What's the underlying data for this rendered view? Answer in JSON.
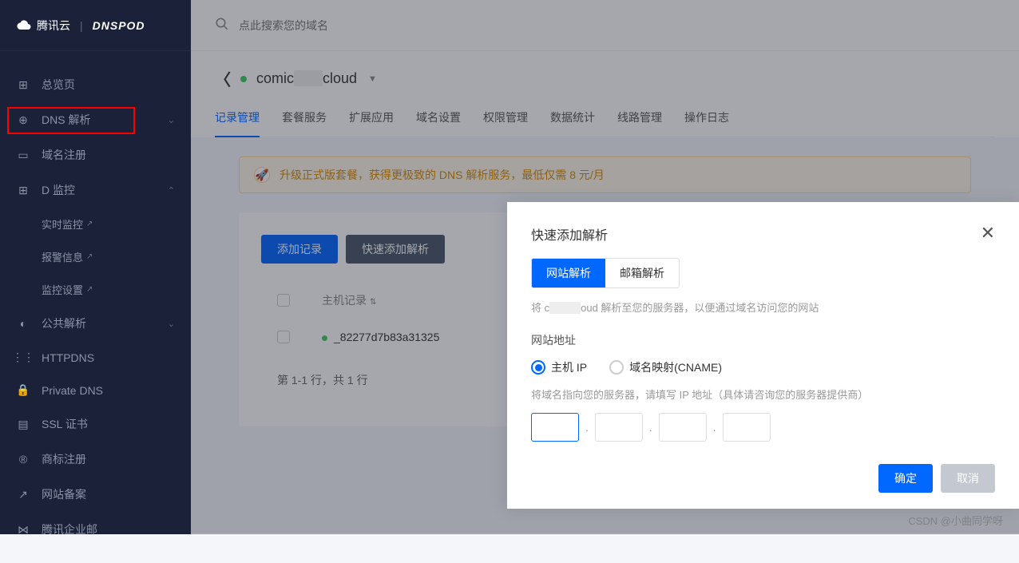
{
  "header": {
    "brand1": "腾讯云",
    "brand2": "DNSPOD"
  },
  "sidebar": {
    "items": [
      {
        "label": "总览页",
        "icon": "⊞"
      },
      {
        "label": "DNS 解析",
        "icon": "⊕",
        "expandable": true,
        "open": false
      },
      {
        "label": "域名注册",
        "icon": "▭"
      },
      {
        "label": "D 监控",
        "icon": "⊞",
        "expandable": true,
        "open": true
      },
      {
        "label": "公共解析",
        "icon": "◐",
        "expandable": true,
        "open": false
      },
      {
        "label": "HTTPDNS",
        "icon": "⋮⋮"
      },
      {
        "label": "Private DNS",
        "icon": "🔒"
      },
      {
        "label": "SSL 证书",
        "icon": "▤"
      },
      {
        "label": "商标注册",
        "icon": "®"
      },
      {
        "label": "网站备案",
        "icon": "↗"
      },
      {
        "label": "腾讯企业邮",
        "icon": "⋈"
      }
    ],
    "subitems": [
      {
        "label": "实时监控"
      },
      {
        "label": "报警信息"
      },
      {
        "label": "监控设置"
      }
    ]
  },
  "search": {
    "placeholder": "点此搜索您的域名"
  },
  "breadcrumb": {
    "domain_prefix": "comic",
    "domain_suffix": "cloud"
  },
  "tabs": [
    {
      "label": "记录管理",
      "active": true
    },
    {
      "label": "套餐服务"
    },
    {
      "label": "扩展应用"
    },
    {
      "label": "域名设置"
    },
    {
      "label": "权限管理"
    },
    {
      "label": "数据统计"
    },
    {
      "label": "线路管理"
    },
    {
      "label": "操作日志"
    }
  ],
  "banner": {
    "text": "升级正式版套餐，获得更极致的 DNS 解析服务，最低仅需 8 元/月"
  },
  "card": {
    "btn_add": "添加记录",
    "btn_quick": "快速添加解析",
    "col_host": "主机记录",
    "row_value": "_82277d7b83a31325",
    "pagination": "第 1-1 行，共 1 行"
  },
  "modal": {
    "title": "快速添加解析",
    "tab_web": "网站解析",
    "tab_mail": "邮箱解析",
    "desc_pre": "将 c",
    "desc_mid": "oud 解析至您的服务器，以便通过域名访问您的网站",
    "field_label": "网站地址",
    "radio_ip": "主机 IP",
    "radio_cname": "域名映射(CNAME)",
    "hint": "将域名指向您的服务器，请填写 IP 地址（具体请咨询您的服务器提供商）",
    "btn_confirm": "确定",
    "btn_cancel": "取消"
  },
  "watermark": "CSDN @小曲同学呀"
}
